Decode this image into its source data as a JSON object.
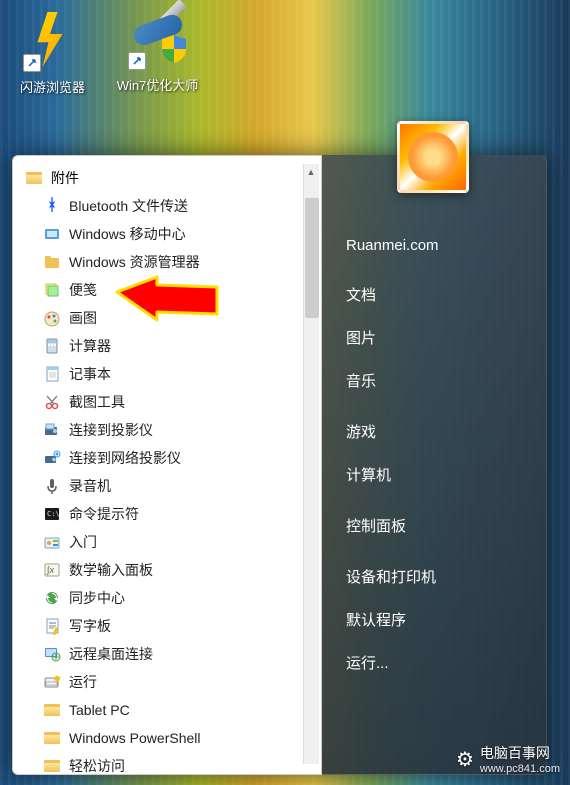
{
  "desktop": {
    "icons": [
      {
        "label": "闪游浏览器",
        "kind": "lightning"
      },
      {
        "label": "Win7优化大师",
        "kind": "knife"
      }
    ]
  },
  "start_menu": {
    "folder_name": "附件",
    "items": [
      {
        "label": "Bluetooth 文件传送",
        "icon": "bluetooth"
      },
      {
        "label": "Windows 移动中心",
        "icon": "mobility"
      },
      {
        "label": "Windows 资源管理器",
        "icon": "explorer"
      },
      {
        "label": "便笺",
        "icon": "sticky"
      },
      {
        "label": "画图",
        "icon": "paint"
      },
      {
        "label": "计算器",
        "icon": "calc"
      },
      {
        "label": "记事本",
        "icon": "notepad"
      },
      {
        "label": "截图工具",
        "icon": "snip"
      },
      {
        "label": "连接到投影仪",
        "icon": "projector"
      },
      {
        "label": "连接到网络投影仪",
        "icon": "netprojector"
      },
      {
        "label": "录音机",
        "icon": "recorder"
      },
      {
        "label": "命令提示符",
        "icon": "cmd"
      },
      {
        "label": "入门",
        "icon": "getstarted"
      },
      {
        "label": "数学输入面板",
        "icon": "math"
      },
      {
        "label": "同步中心",
        "icon": "sync"
      },
      {
        "label": "写字板",
        "icon": "wordpad"
      },
      {
        "label": "远程桌面连接",
        "icon": "rdp"
      },
      {
        "label": "运行",
        "icon": "run"
      },
      {
        "label": "Tablet PC",
        "icon": "folder"
      },
      {
        "label": "Windows PowerShell",
        "icon": "folder"
      },
      {
        "label": "轻松访问",
        "icon": "folder"
      }
    ]
  },
  "right_panel": {
    "username": "Ruanmei.com",
    "items": [
      "文档",
      "图片",
      "音乐",
      "游戏",
      "计算机",
      "控制面板",
      "设备和打印机",
      "默认程序",
      "运行..."
    ]
  },
  "watermark": {
    "title": "电脑百事网",
    "url": "www.pc841.com"
  },
  "annotation": {
    "arrow_target_index": 3
  }
}
